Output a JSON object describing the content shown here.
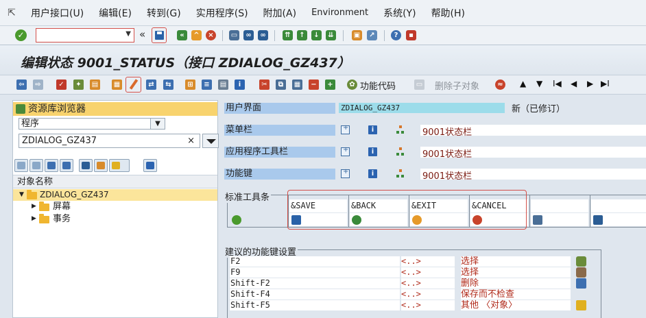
{
  "menubar": {
    "items": [
      "用户接口(U)",
      "编辑(E)",
      "转到(G)",
      "实用程序(S)",
      "附加(A)",
      "Environment",
      "系统(Y)",
      "帮助(H)"
    ]
  },
  "systoolbar": {
    "command_value": "",
    "icons": [
      "enter-icon",
      "save-icon",
      "back-icon",
      "exit-icon",
      "cancel-icon",
      "print-icon",
      "find-icon",
      "find-next-icon",
      "first-page-icon",
      "previous-page-icon",
      "next-page-icon",
      "last-page-icon",
      "new-session-icon",
      "shortcut-icon",
      "help-icon",
      "customize-layout-icon"
    ]
  },
  "title": "编辑状态 9001_STATUS（接口 ZDIALOG_GZ437）",
  "apptoolbar": {
    "function_code_label": "功能代码",
    "delete_subobject_label": "删除子对象"
  },
  "repository": {
    "header": "资源库浏览器",
    "object_type": "程序",
    "object_name": "ZDIALOG_GZ437",
    "column_header": "对象名称",
    "tree_root": "ZDIALOG_GZ437",
    "tree_children": [
      "屏幕",
      "事务"
    ]
  },
  "status_screen": {
    "user_interface_label": "用户界面",
    "user_interface_value": "ZDIALOG_GZ437",
    "status_text": "新（已修订）",
    "rows": [
      {
        "label": "菜单栏",
        "value": "9001状态栏"
      },
      {
        "label": "应用程序工具栏",
        "value": "9001状态栏"
      },
      {
        "label": "功能键",
        "value": "9001状态栏"
      }
    ]
  },
  "standard_toolbar": {
    "title": "标准工具条",
    "cells": [
      {
        "name": "&SAVE",
        "icon": "save-icon"
      },
      {
        "name": "&BACK",
        "icon": "back-icon"
      },
      {
        "name": "&EXIT",
        "icon": "exit-icon"
      },
      {
        "name": "&CANCEL",
        "icon": "cancel-icon"
      },
      {
        "name": "",
        "icon": "print-icon"
      },
      {
        "name": "",
        "icon": "find-icon"
      }
    ]
  },
  "suggested_keys": {
    "title": "建议的功能键设置",
    "rows": [
      {
        "key": "F2",
        "code": "<..>",
        "text": "选择",
        "icon": "select-icon"
      },
      {
        "key": "F9",
        "code": "<..>",
        "text": "选择",
        "icon": "select-detail-icon"
      },
      {
        "key": "Shift-F2",
        "code": "<..>",
        "text": "删除",
        "icon": "delete-icon"
      },
      {
        "key": "Shift-F4",
        "code": "<..>",
        "text": "保存而不检查",
        "icon": ""
      },
      {
        "key": "Shift-F5",
        "code": "<..>",
        "text": "其他 〈对象〉",
        "icon": "other-object-icon"
      }
    ]
  },
  "colors": {
    "accent_red": "#d3504a",
    "label_blue": "#a9c9ec",
    "value_cyan": "#9cdcea",
    "repo_header_yellow": "#f8d36e"
  }
}
